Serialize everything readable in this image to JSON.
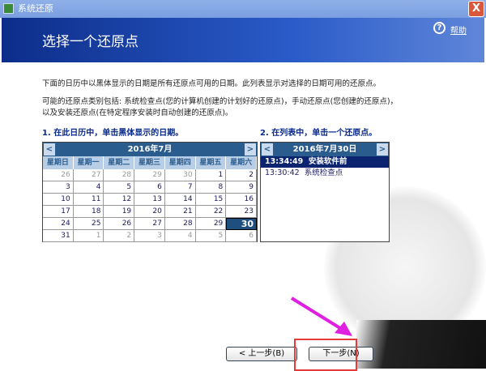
{
  "window": {
    "title": "系统还原",
    "close": "X"
  },
  "header": {
    "title": "选择一个还原点",
    "help": "帮助",
    "help_icon": "?"
  },
  "desc": {
    "line1": "下面的日历中以黑体显示的日期是所有还原点可用的日期。此列表显示对选择的日期可用的还原点。",
    "line2": "可能的还原点类别包括: 系统检查点(您的计算机创建的计划好的还原点)，手动还原点(您创建的还原点)，",
    "line3": "以及安装还原点(在特定程序安装时自动创建的还原点)。"
  },
  "steps": {
    "step1": "1. 在此日历中，单击黑体显示的日期。",
    "step2": "2. 在列表中，单击一个还原点。"
  },
  "calendar": {
    "month": "2016年7月",
    "prev": "<",
    "next": ">",
    "weekdays": [
      "星期日",
      "星期一",
      "星期二",
      "星期三",
      "星期四",
      "星期五",
      "星期六"
    ],
    "days": [
      "26",
      "27",
      "28",
      "29",
      "30",
      "1",
      "2",
      "3",
      "4",
      "5",
      "6",
      "7",
      "8",
      "9",
      "10",
      "11",
      "12",
      "13",
      "14",
      "15",
      "16",
      "17",
      "18",
      "19",
      "20",
      "21",
      "22",
      "23",
      "24",
      "25",
      "26",
      "27",
      "28",
      "29",
      "30",
      "31",
      "1",
      "2",
      "3",
      "4",
      "5",
      "6"
    ],
    "selected": "30"
  },
  "restore_list": {
    "date": "2016年7月30日",
    "prev": "<",
    "next": ">",
    "items": [
      {
        "time": "13:34:49",
        "name": "安装软件前"
      },
      {
        "time": "13:30:42",
        "name": "系统检查点"
      }
    ]
  },
  "buttons": {
    "back": "< 上一步(B)",
    "next": "下一步(N)"
  }
}
